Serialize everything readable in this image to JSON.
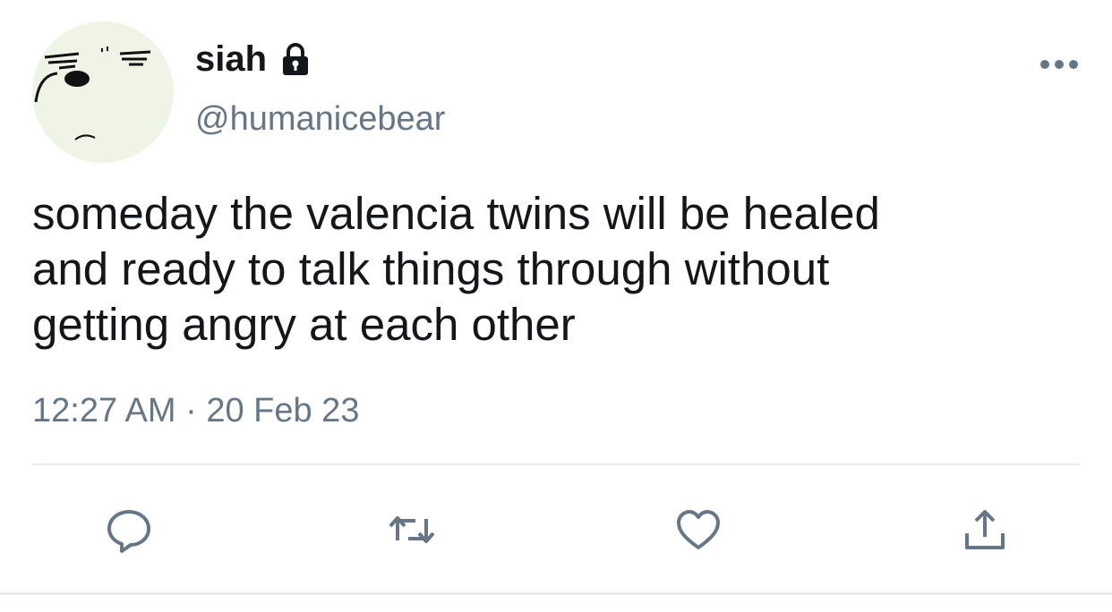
{
  "user": {
    "display_name": "siah",
    "handle": "@humanicebear",
    "locked_icon": "lock-icon",
    "avatar": "cartoon-face-avatar"
  },
  "tweet": {
    "text": "someday the valencia twins will be healed\nand ready to talk things through without\ngetting angry at each other",
    "timestamp": "12:27 AM · 20 Feb 23"
  },
  "actions": [
    {
      "name": "reply",
      "icon": "comment-icon"
    },
    {
      "name": "retweet",
      "icon": "retweet-icon"
    },
    {
      "name": "like",
      "icon": "heart-icon"
    },
    {
      "name": "share",
      "icon": "share-icon"
    }
  ],
  "colors": {
    "text": "#14171a",
    "secondary": "#657786",
    "icon": "#657786",
    "divider": "#e6ecf0",
    "avatar_bg": "#eef4e6"
  }
}
